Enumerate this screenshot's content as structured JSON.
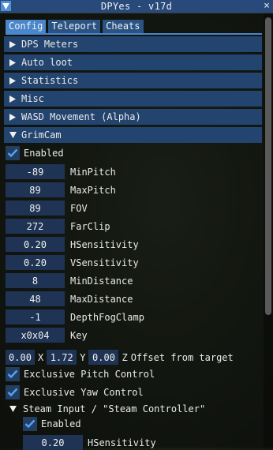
{
  "window": {
    "title": "DPYes - v17d",
    "close_glyph": "×"
  },
  "tabs": [
    {
      "label": "Config",
      "active": true
    },
    {
      "label": "Teleport",
      "active": false
    },
    {
      "label": "Cheats",
      "active": false
    }
  ],
  "sections": [
    {
      "label": "DPS Meters",
      "expanded": false
    },
    {
      "label": "Auto loot",
      "expanded": false
    },
    {
      "label": "Statistics",
      "expanded": false
    },
    {
      "label": "Misc",
      "expanded": false
    },
    {
      "label": "WASD Movement (Alpha)",
      "expanded": false
    },
    {
      "label": "GrimCam",
      "expanded": true
    }
  ],
  "grimcam": {
    "enabled": {
      "label": "Enabled",
      "checked": true
    },
    "fields": [
      {
        "value": "-89",
        "label": "MinPitch"
      },
      {
        "value": "89",
        "label": "MaxPitch"
      },
      {
        "value": "89",
        "label": "FOV"
      },
      {
        "value": "272",
        "label": "FarClip"
      },
      {
        "value": "0.20",
        "label": "HSensitivity"
      },
      {
        "value": "0.20",
        "label": "VSensitivity"
      },
      {
        "value": "8",
        "label": "MinDistance"
      },
      {
        "value": "48",
        "label": "MaxDistance"
      },
      {
        "value": "-1",
        "label": "DepthFogClamp"
      },
      {
        "value": "x0x04",
        "label": "Key"
      }
    ],
    "offset": {
      "x_value": "0.00",
      "x_label": "X",
      "y_value": "1.72",
      "y_label": "Y",
      "z_value": "0.00",
      "z_label": "Z",
      "label": "Offset from target"
    },
    "exclusive_pitch": {
      "label": "Exclusive Pitch Control",
      "checked": true
    },
    "exclusive_yaw": {
      "label": "Exclusive Yaw Control",
      "checked": true
    },
    "steam_input": {
      "label": "Steam Input / \"Steam Controller\"",
      "expanded": true,
      "enabled": {
        "label": "Enabled",
        "checked": true
      },
      "hsens": {
        "value": "0.20",
        "label": "HSensitivity"
      }
    }
  },
  "colors": {
    "accent": "#4a86cc",
    "header_bg": "#23446e",
    "field_bg": "#1f3454",
    "title_bg": "#284a7a"
  }
}
